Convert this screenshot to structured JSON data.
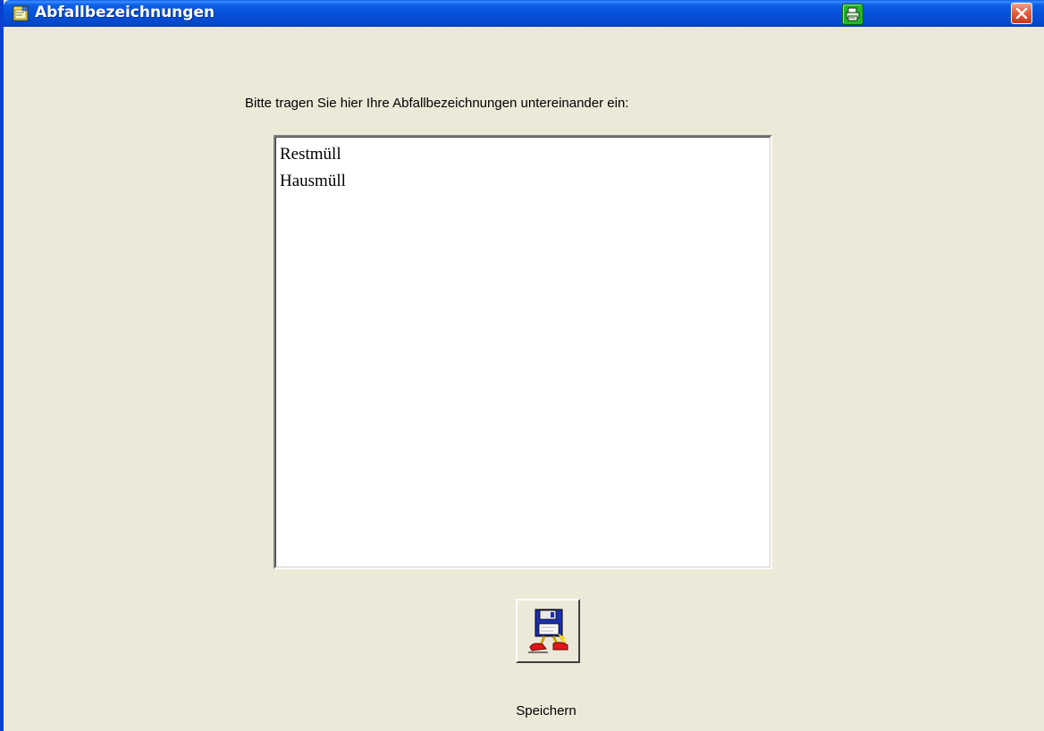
{
  "window": {
    "title": "Abfallbezeichnungen",
    "app_icon": "notepad-icon",
    "print_icon": "printer-icon",
    "close_icon": "close-icon"
  },
  "form": {
    "instruction": "Bitte tragen Sie hier Ihre Abfallbezeichnungen untereinander ein:",
    "entries": [
      "Restmüll",
      "Hausmüll"
    ],
    "save_label": "Speichern",
    "save_icon": "floppy-disk-running-icon"
  },
  "colors": {
    "titlebar": "#0650d8",
    "window_background": "#ece9d8",
    "print_button": "#22b82a",
    "close_button": "#e2603e"
  }
}
